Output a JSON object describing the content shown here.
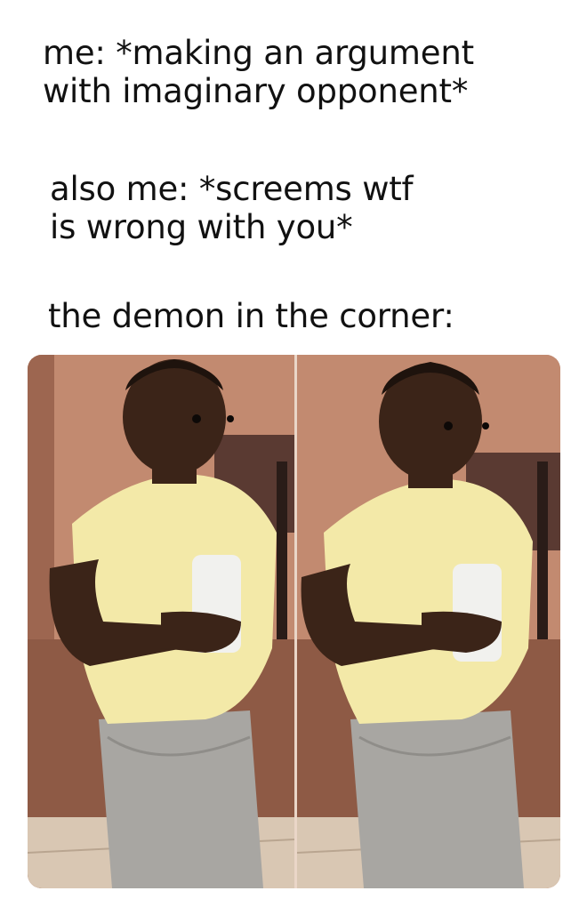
{
  "captions": {
    "line1": "me: *making an argument\nwith imaginary opponent*",
    "line2": "also me: *screems wtf\nis wrong with you*",
    "line3": "the demon in the corner:"
  },
  "photo": {
    "frames": 2,
    "colors": {
      "wall": "#c28a70",
      "shirt": "#f3e9a8",
      "shorts": "#a8a6a2",
      "skin": "#3b2418",
      "floor": "#d9c7b3"
    }
  }
}
